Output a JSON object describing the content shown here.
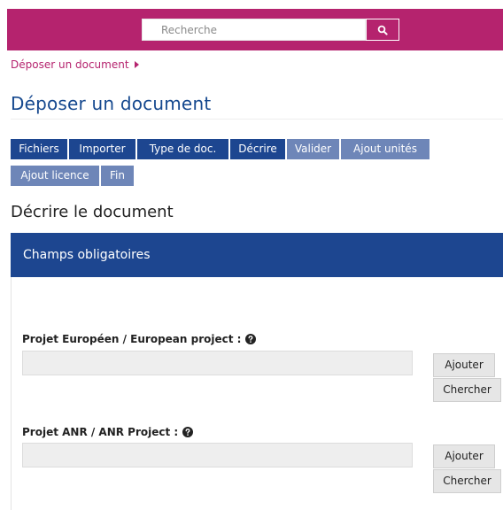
{
  "header": {
    "search": {
      "placeholder": "Recherche",
      "icon": "search-icon"
    },
    "brand_color": "#b5236e"
  },
  "breadcrumb": {
    "label": "Déposer un document"
  },
  "page": {
    "title": "Déposer un document",
    "title_color": "#16498f"
  },
  "steps": {
    "tabs": [
      {
        "label": "Fichiers",
        "state": "done"
      },
      {
        "label": "Importer",
        "state": "done"
      },
      {
        "label": "Type de doc.",
        "state": "done"
      },
      {
        "label": "Décrire",
        "state": "current"
      },
      {
        "label": "Valider",
        "state": "pending"
      },
      {
        "label": "Ajout unités",
        "state": "pending"
      },
      {
        "label": "Ajout licence",
        "state": "pending"
      },
      {
        "label": "Fin",
        "state": "pending"
      }
    ],
    "active_color": "#1d4690",
    "inactive_color": "#6e86b8"
  },
  "section": {
    "title": "Décrire le document",
    "panel_title": "Champs obligatoires"
  },
  "fields": [
    {
      "label": "Projet Européen / European project :",
      "help_icon": "question-circle-icon",
      "value": "",
      "add_label": "Ajouter",
      "search_label": "Chercher"
    },
    {
      "label": "Projet ANR / ANR Project :",
      "help_icon": "question-circle-icon",
      "value": "",
      "add_label": "Ajouter",
      "search_label": "Chercher"
    }
  ]
}
